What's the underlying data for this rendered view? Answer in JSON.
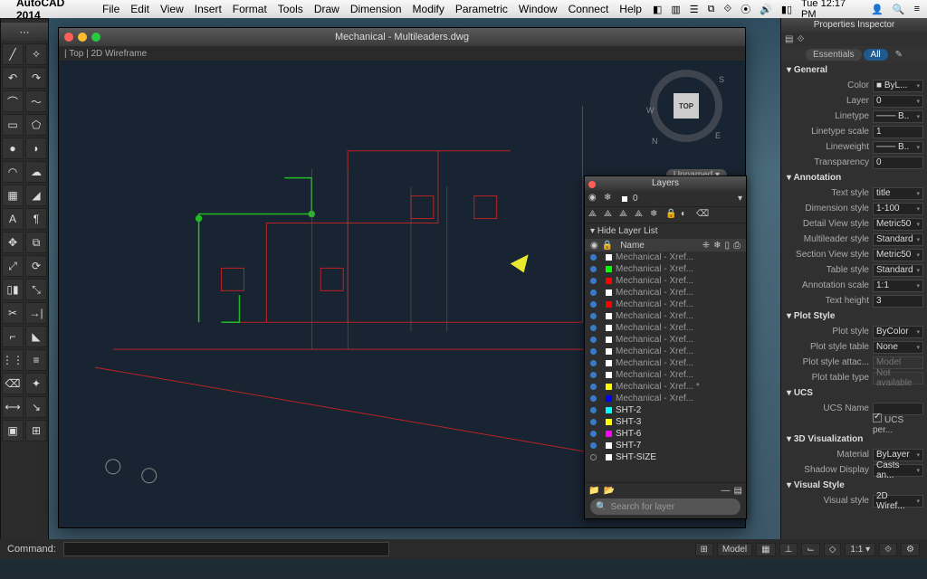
{
  "menubar": {
    "app": "AutoCAD 2014",
    "items": [
      "File",
      "Edit",
      "View",
      "Insert",
      "Format",
      "Tools",
      "Draw",
      "Dimension",
      "Modify",
      "Parametric",
      "Window",
      "Connect",
      "Help"
    ],
    "clock": "Tue 12:17 PM"
  },
  "document": {
    "title": "Mechanical - Multileaders.dwg",
    "viewbar": "|  Top  | 2D Wireframe",
    "viewcube_face": "TOP",
    "viewcube_n": "N",
    "viewcube_s": "S",
    "viewcube_e": "E",
    "viewcube_w": "W",
    "unnamed_tag": "Unnamed  ▾"
  },
  "layers": {
    "title": "Layers",
    "current_layer": "0",
    "hide_label": "Hide Layer List",
    "name_col": "Name",
    "items": [
      {
        "color": "#ffffff",
        "swatch": "#ffffff",
        "label": "Mechanical - Xref...",
        "ref": true
      },
      {
        "color": "#00ff00",
        "swatch": "#00ff00",
        "label": "Mechanical - Xref...",
        "ref": true
      },
      {
        "color": "#ff0000",
        "swatch": "#ff0000",
        "label": "Mechanical - Xref...",
        "ref": true
      },
      {
        "color": "#ffffff",
        "swatch": "#ffffff",
        "label": "Mechanical - Xref...",
        "ref": true
      },
      {
        "color": "#ff0000",
        "swatch": "#ff0000",
        "label": "Mechanical - Xref...",
        "ref": true
      },
      {
        "color": "#ffffff",
        "swatch": "#ffffff",
        "label": "Mechanical - Xref...",
        "ref": true
      },
      {
        "color": "#ffffff",
        "swatch": "#ffffff",
        "label": "Mechanical - Xref...",
        "ref": true
      },
      {
        "color": "#ffffff",
        "swatch": "#ffffff",
        "label": "Mechanical - Xref...",
        "ref": true
      },
      {
        "color": "#ffffff",
        "swatch": "#ffffff",
        "label": "Mechanical - Xref...",
        "ref": true
      },
      {
        "color": "#ffffff",
        "swatch": "#ffffff",
        "label": "Mechanical - Xref...",
        "ref": true
      },
      {
        "color": "#ffffff",
        "swatch": "#ffffff",
        "label": "Mechanical - Xref...",
        "ref": true
      },
      {
        "color": "#ffff00",
        "swatch": "#ffff00",
        "label": "Mechanical - Xref...  *",
        "ref": true
      },
      {
        "color": "#0000ff",
        "swatch": "#0000ff",
        "label": "Mechanical - Xref...",
        "ref": true
      },
      {
        "color": "#00ffff",
        "swatch": "#00ffff",
        "label": "SHT-2",
        "ref": false
      },
      {
        "color": "#ffff00",
        "swatch": "#ffff00",
        "label": "SHT-3",
        "ref": false
      },
      {
        "color": "#ff00ff",
        "swatch": "#ff00ff",
        "label": "SHT-6",
        "ref": false
      },
      {
        "color": "#ffffff",
        "swatch": "#ffffff",
        "label": "SHT-7",
        "ref": false
      },
      {
        "color": "#ffffff",
        "swatch": "#ffffff",
        "label": "SHT-SIZE",
        "ref": false,
        "open": true
      }
    ],
    "search_placeholder": "Search for layer"
  },
  "properties": {
    "title": "Properties Inspector",
    "tab_essentials": "Essentials",
    "tab_all": "All",
    "sections": {
      "general": "General",
      "annotation": "Annotation",
      "plot": "Plot Style",
      "ucs": "UCS",
      "viz3d": "3D Visualization",
      "visual": "Visual Style"
    },
    "general": {
      "color_l": "Color",
      "color_v": "■ ByL...",
      "layer_l": "Layer",
      "layer_v": "0",
      "linetype_l": "Linetype",
      "linetype_v": "─── B..",
      "lscale_l": "Linetype scale",
      "lscale_v": "1",
      "lweight_l": "Lineweight",
      "lweight_v": "─── B..",
      "trans_l": "Transparency",
      "trans_v": "0"
    },
    "annotation": {
      "textstyle_l": "Text style",
      "textstyle_v": "title",
      "dimstyle_l": "Dimension style",
      "dimstyle_v": "1-100",
      "detail_l": "Detail View style",
      "detail_v": "Metric50",
      "mleader_l": "Multileader style",
      "mleader_v": "Standard",
      "section_l": "Section View style",
      "section_v": "Metric50",
      "table_l": "Table style",
      "table_v": "Standard",
      "ascale_l": "Annotation scale",
      "ascale_v": "1:1",
      "theight_l": "Text height",
      "theight_v": "3"
    },
    "plot": {
      "pstyle_l": "Plot style",
      "pstyle_v": "ByColor",
      "ptable_l": "Plot style table",
      "ptable_v": "None",
      "pattach_l": "Plot style attac...",
      "pattach_v": "Model",
      "pttype_l": "Plot table type",
      "pttype_v": "Not available"
    },
    "ucs": {
      "name_l": "UCS Name",
      "name_v": "",
      "per_l": "UCS per..."
    },
    "viz3d": {
      "mat_l": "Material",
      "mat_v": "ByLayer",
      "shadow_l": "Shadow Display",
      "shadow_v": "Casts an..."
    },
    "visual": {
      "vs_l": "Visual style",
      "vs_v": "2D Wiref..."
    }
  },
  "command": {
    "label": "Command:",
    "value": ""
  },
  "status": {
    "model": "Model",
    "scale": "1:1"
  }
}
